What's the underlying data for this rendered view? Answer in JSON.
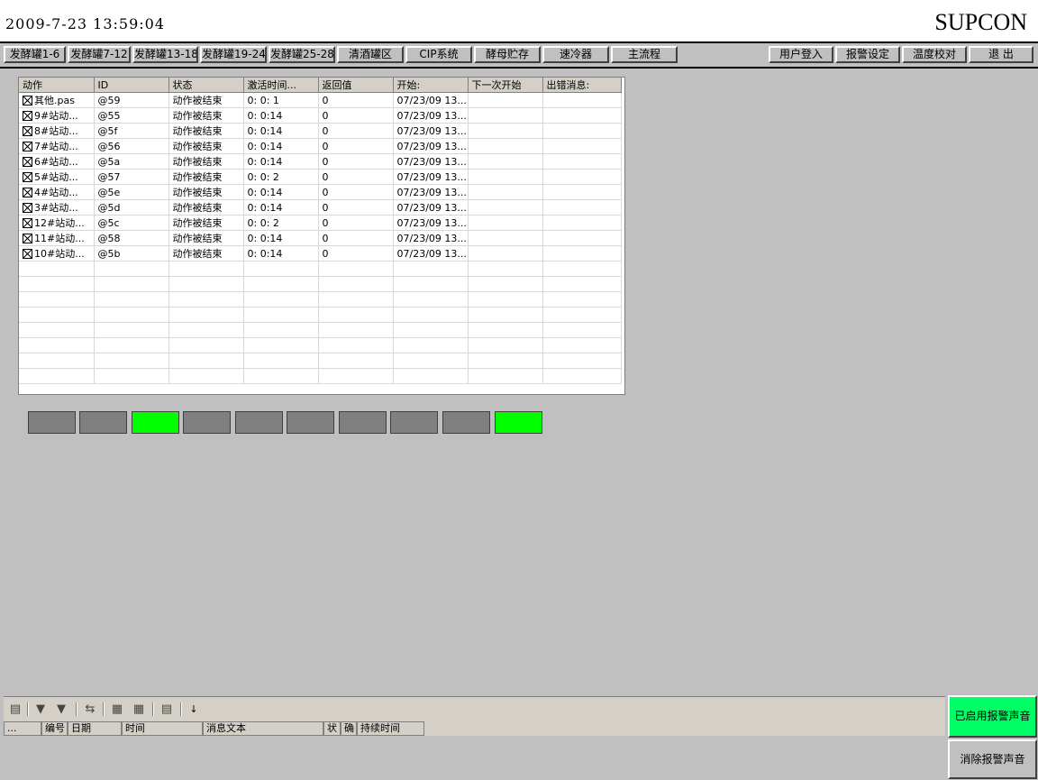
{
  "header": {
    "datetime": "2009-7-23  13:59:04",
    "brand": "SUPCON"
  },
  "nav": {
    "left": [
      "发酵罐1-6",
      "发酵罐7-12",
      "发酵罐13-18",
      "发酵罐19-24",
      "发酵罐25-28",
      "清酒罐区",
      "CIP系统",
      "酵母贮存",
      "速冷器",
      "主流程"
    ],
    "right": [
      "用户登入",
      "报警设定",
      "温度校对",
      "退 出"
    ]
  },
  "grid": {
    "columns": [
      "动作",
      "ID",
      "状态",
      "激活时间...",
      "返回值",
      "开始:",
      "下一次开始",
      "出错消息:"
    ],
    "rows": [
      [
        "其他.pas",
        "@59",
        "动作被结束",
        "0: 0: 1",
        "0",
        "07/23/09 13...",
        "",
        ""
      ],
      [
        "9#站动...",
        "@55",
        "动作被结束",
        "0: 0:14",
        "0",
        "07/23/09 13...",
        "",
        ""
      ],
      [
        "8#站动...",
        "@5f",
        "动作被结束",
        "0: 0:14",
        "0",
        "07/23/09 13...",
        "",
        ""
      ],
      [
        "7#站动...",
        "@56",
        "动作被结束",
        "0: 0:14",
        "0",
        "07/23/09 13...",
        "",
        ""
      ],
      [
        "6#站动...",
        "@5a",
        "动作被结束",
        "0: 0:14",
        "0",
        "07/23/09 13...",
        "",
        ""
      ],
      [
        "5#站动...",
        "@57",
        "动作被结束",
        "0: 0: 2",
        "0",
        "07/23/09 13...",
        "",
        ""
      ],
      [
        "4#站动...",
        "@5e",
        "动作被结束",
        "0: 0:14",
        "0",
        "07/23/09 13...",
        "",
        ""
      ],
      [
        "3#站动...",
        "@5d",
        "动作被结束",
        "0: 0:14",
        "0",
        "07/23/09 13...",
        "",
        ""
      ],
      [
        "12#站动...",
        "@5c",
        "动作被结束",
        "0: 0: 2",
        "0",
        "07/23/09 13...",
        "",
        ""
      ],
      [
        "11#站动...",
        "@58",
        "动作被结束",
        "0: 0:14",
        "0",
        "07/23/09 13...",
        "",
        ""
      ],
      [
        "10#站动...",
        "@5b",
        "动作被结束",
        "0: 0:14",
        "0",
        "07/23/09 13...",
        "",
        ""
      ]
    ]
  },
  "indicators": {
    "states": [
      "off",
      "off",
      "on",
      "off",
      "off",
      "off",
      "off",
      "off",
      "off",
      "on"
    ],
    "on_color": "#00ff00",
    "off_color": "#808080"
  },
  "alarm": {
    "tools": [
      "list-icon",
      "ack-icon",
      "ack-all-icon",
      "loop-icon",
      "lock-icon",
      "history-icon",
      "filter-icon",
      "sort-icon"
    ],
    "columns": [
      "...",
      "编号",
      "日期",
      "时间",
      "消息文本",
      "状",
      "确",
      "持续时间"
    ],
    "sound_on_label": "已启用报警声音",
    "sound_on_color": "#00ff66",
    "clear_sound_label": "消除报警声音"
  }
}
